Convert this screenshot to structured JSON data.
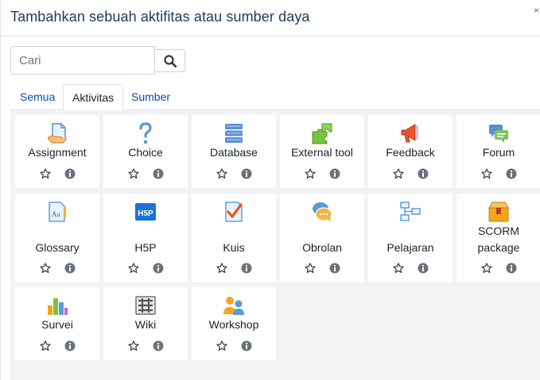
{
  "modal": {
    "title": "Tambahkan sebuah aktifitas atau sumber daya",
    "close_label": "×"
  },
  "search": {
    "placeholder": "Cari",
    "button_icon": "search-icon"
  },
  "tabs": [
    {
      "label": "Semua",
      "active": false
    },
    {
      "label": "Aktivitas",
      "active": true
    },
    {
      "label": "Sumber",
      "active": false
    }
  ],
  "modules": [
    {
      "label": "Assignment",
      "icon": "assignment-icon"
    },
    {
      "label": "Choice",
      "icon": "choice-icon"
    },
    {
      "label": "Database",
      "icon": "database-icon"
    },
    {
      "label": "External tool",
      "icon": "external-tool-icon"
    },
    {
      "label": "Feedback",
      "icon": "feedback-icon"
    },
    {
      "label": "Forum",
      "icon": "forum-icon"
    },
    {
      "label": "Glossary",
      "icon": "glossary-icon"
    },
    {
      "label": "H5P",
      "icon": "h5p-icon"
    },
    {
      "label": "Kuis",
      "icon": "quiz-icon"
    },
    {
      "label": "Obrolan",
      "icon": "chat-icon"
    },
    {
      "label": "Pelajaran",
      "icon": "lesson-icon"
    },
    {
      "label": "SCORM package",
      "icon": "scorm-icon"
    },
    {
      "label": "Survei",
      "icon": "survey-icon"
    },
    {
      "label": "Wiki",
      "icon": "wiki-icon"
    },
    {
      "label": "Workshop",
      "icon": "workshop-icon"
    }
  ],
  "colors": {
    "title": "#1d3a5f",
    "link": "#0f47ad",
    "grid_background": "#f2f3f5",
    "info_icon": "#6a737b"
  }
}
